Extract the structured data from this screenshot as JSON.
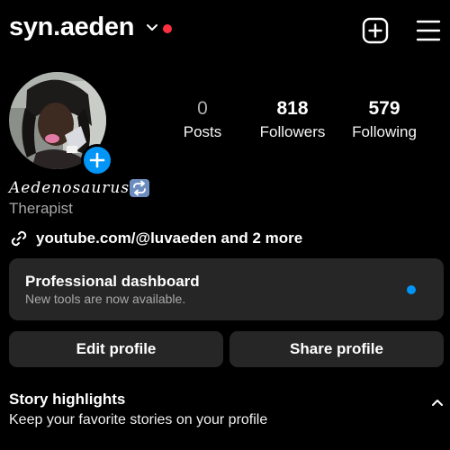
{
  "header": {
    "username": "syn.aeden",
    "icons": [
      "chevron-down-icon",
      "notification-dot",
      "create-plus-icon",
      "menu-hamburger-icon"
    ],
    "accent_red": "#ff3040"
  },
  "profile": {
    "display_name": "Aedenosaurus",
    "category": "Therapist",
    "link_text": "youtube.com/@luvaeden and 2 more"
  },
  "stats": [
    {
      "value": "0",
      "label": "Posts"
    },
    {
      "value": "818",
      "label": "Followers"
    },
    {
      "value": "579",
      "label": "Following"
    }
  ],
  "dashboard": {
    "title": "Professional dashboard",
    "subtitle": "New tools are now available.",
    "dot_color": "#0095f6"
  },
  "buttons": {
    "edit_profile": "Edit profile",
    "share_profile": "Share profile"
  },
  "highlights": {
    "title": "Story highlights",
    "subtitle": "Keep your favorite stories on your profile"
  },
  "colors": {
    "background": "#000000",
    "card": "#262626",
    "accent_blue": "#0095f6",
    "muted_text": "#a8a8a8"
  }
}
